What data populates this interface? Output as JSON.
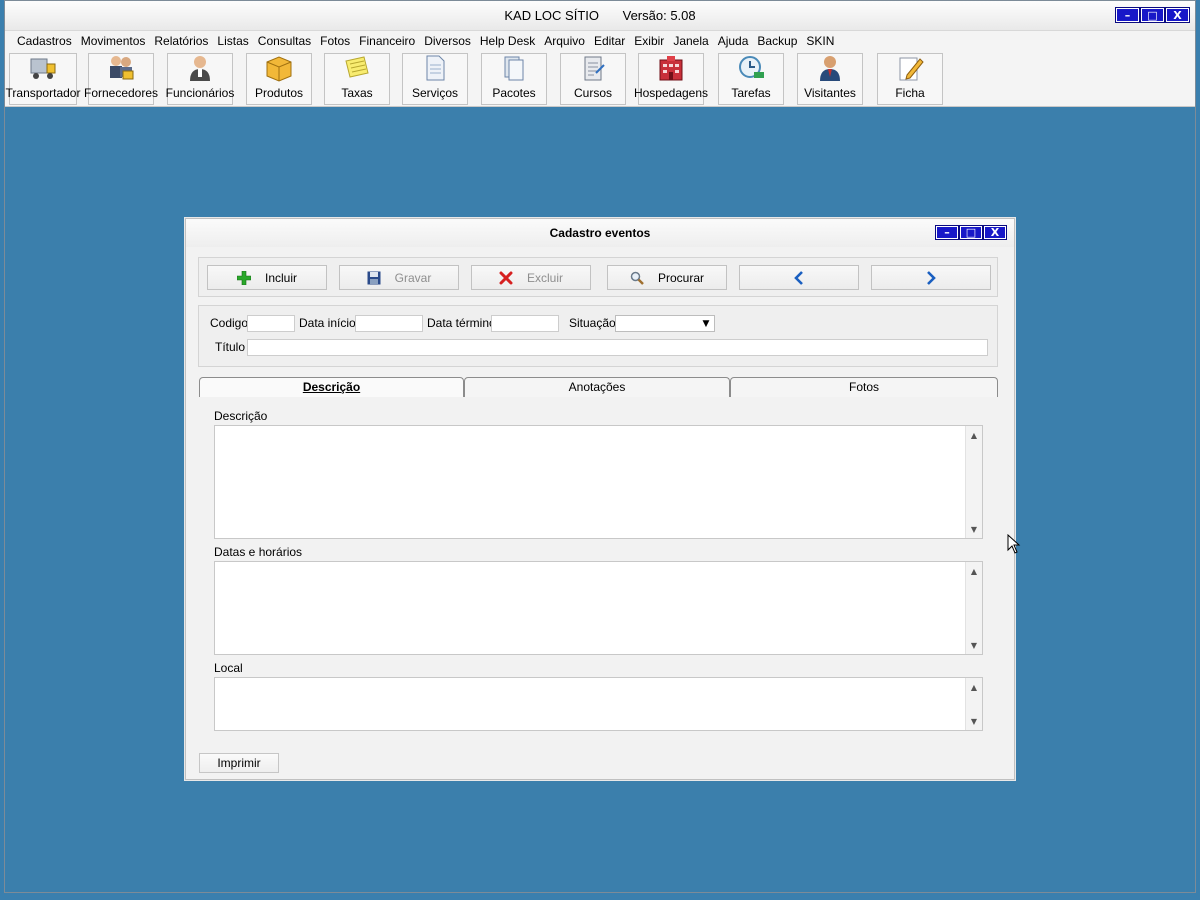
{
  "app": {
    "title": "KAD LOC SÍTIO",
    "version": "Versão: 5.08"
  },
  "window_controls": {
    "minimize": "–",
    "maximize": "□",
    "close": "X"
  },
  "menu": [
    "Cadastros",
    "Movimentos",
    "Relatórios",
    "Listas",
    "Consultas",
    "Fotos",
    "Financeiro",
    "Diversos",
    "Help Desk",
    "Arquivo",
    "Editar",
    "Exibir",
    "Janela",
    "Ajuda",
    "Backup",
    "SKIN"
  ],
  "toolbar": [
    {
      "label": "Transportador",
      "icon": "truck-icon"
    },
    {
      "label": "Fornecedores",
      "icon": "suppliers-icon"
    },
    {
      "label": "Funcionários",
      "icon": "employee-icon"
    },
    {
      "label": "Produtos",
      "icon": "box-icon"
    },
    {
      "label": "Taxas",
      "icon": "notepad-icon"
    },
    {
      "label": "Serviços",
      "icon": "document-icon"
    },
    {
      "label": "Pacotes",
      "icon": "pages-icon"
    },
    {
      "label": "Cursos",
      "icon": "clipboard-icon"
    },
    {
      "label": "Hospedagens",
      "icon": "hotel-icon"
    },
    {
      "label": "Tarefas",
      "icon": "clock-icon"
    },
    {
      "label": "Visitantes",
      "icon": "visitor-icon"
    },
    {
      "label": "Ficha",
      "icon": "pencil-paper-icon"
    }
  ],
  "dialog": {
    "title": "Cadastro eventos",
    "actions": {
      "include": "Incluir",
      "save": "Gravar",
      "delete": "Excluir",
      "search": "Procurar",
      "prev": "",
      "next": ""
    },
    "fields": {
      "codigo": {
        "label": "Codigo",
        "value": ""
      },
      "data_inicio": {
        "label": "Data início",
        "value": ""
      },
      "data_termino": {
        "label": "Data término",
        "value": ""
      },
      "situacao": {
        "label": "Situação",
        "value": ""
      },
      "titulo": {
        "label": "Título",
        "value": ""
      }
    },
    "tabs": [
      "Descrição",
      "Anotações",
      "Fotos"
    ],
    "active_tab": "Descrição",
    "sections": {
      "descricao": "Descrição",
      "datas": "Datas e horários",
      "local": "Local"
    },
    "print": "Imprimir"
  },
  "colors": {
    "desktop": "#3a7fae",
    "window_button": "#1818c8",
    "include_icon": "#2aa82a",
    "delete_icon": "#d62020",
    "nav_arrow": "#1a5fc0"
  }
}
